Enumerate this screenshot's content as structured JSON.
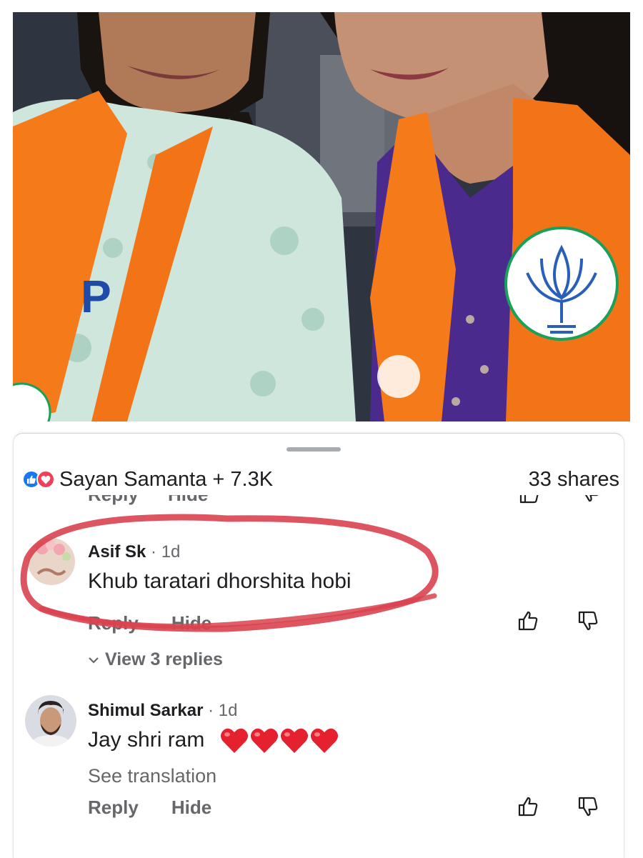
{
  "reactions": {
    "names": "Sayan Samanta + 7.3K",
    "shares": "33 shares",
    "like_icon": "like-icon",
    "love_icon": "love-icon"
  },
  "previous_comment_actions": {
    "reply": "Reply",
    "hide": "Hide"
  },
  "comments": [
    {
      "name": "Asif Sk",
      "time": "· 1d",
      "text": "Khub taratari dhorshita hobi",
      "reply": "Reply",
      "hide": "Hide",
      "view_replies": "View 3 replies"
    },
    {
      "name": "Shimul Sarkar",
      "time": "· 1d",
      "text": "Jay shri ram",
      "hearts": "❤❤❤❤",
      "see_translation": "See translation",
      "reply": "Reply",
      "hide": "Hide"
    }
  ],
  "annotation": {
    "color": "#d9434f"
  },
  "colors": {
    "like_blue": "#1877f2",
    "love_red": "#f33e58",
    "saffron": "#f57a1a"
  }
}
